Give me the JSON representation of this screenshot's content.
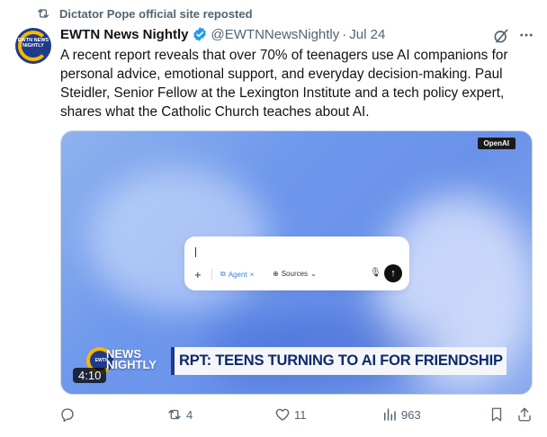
{
  "repost": {
    "text": "Dictator Pope official site reposted"
  },
  "author": {
    "avatar_text": "EWTN NEWS NIGHTLY",
    "name": "EWTN News Nightly",
    "handle": "@EWTNNewsNightly",
    "separator": "·",
    "date": "Jul 24"
  },
  "tweet": {
    "text": "A recent report reveals that over 70% of teenagers use AI companions for personal advice, emotional support, and everyday decision-making. Paul Steidler, Senior Fellow at the Lexington Institute and a tech policy expert, shares what the Catholic Church teaches about AI."
  },
  "media": {
    "badge": "OpenAI",
    "chat": {
      "plus": "+",
      "agent": "Agent",
      "agent_close": "×",
      "sources": "Sources",
      "sources_caret": "⌄"
    },
    "logo_ring": "EWTN",
    "logo_line1": "NEWS",
    "logo_line2": "NIGHTLY",
    "banner": "RPT: TEENS TURNING TO AI FOR FRIENDSHIP",
    "duration": "4:10"
  },
  "actions": {
    "reply_count": "",
    "repost_count": "4",
    "like_count": "11",
    "views_count": "963"
  },
  "colors": {
    "accent": "#1d9bf0",
    "muted": "#536471",
    "banner_text": "#0c2a6e",
    "brand_gold": "#f5b800"
  }
}
